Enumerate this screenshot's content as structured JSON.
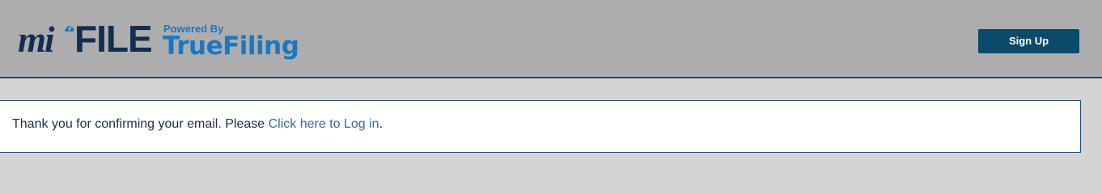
{
  "header": {
    "logo": {
      "mi": "mi",
      "file": "FILE",
      "powered_by": "Powered By",
      "brand": "TrueFiling"
    },
    "signup_label": "Sign Up"
  },
  "message": {
    "text_before": "Thank you for confirming your email. Please ",
    "link_label": "Click here to Log in",
    "text_after": "."
  },
  "colors": {
    "header_bg": "#adadad",
    "page_bg": "#d4d4d5",
    "brand_dark": "#132d52",
    "brand_blue": "#1878c4",
    "button_bg": "#0b4a6a",
    "link": "#2f6aa3"
  }
}
